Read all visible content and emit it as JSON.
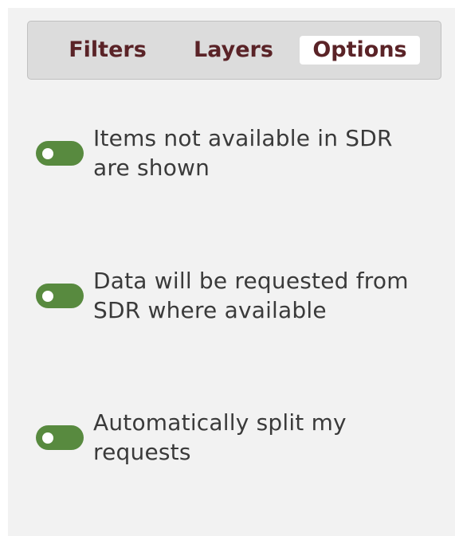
{
  "tabs": [
    {
      "label": "Filters",
      "active": false
    },
    {
      "label": "Layers",
      "active": false
    },
    {
      "label": "Options",
      "active": true
    }
  ],
  "options": [
    {
      "label": "Items not available in SDR are shown",
      "enabled": true
    },
    {
      "label": "Data will be requested from SDR where available",
      "enabled": true
    },
    {
      "label": "Automatically split my requests",
      "enabled": true
    }
  ],
  "colors": {
    "toggle_on": "#588a3f",
    "tab_text": "#5a2327",
    "panel_bg": "#f2f2f2",
    "tabbar_bg": "#dcdcdc",
    "label_text": "#3a3a3a"
  }
}
